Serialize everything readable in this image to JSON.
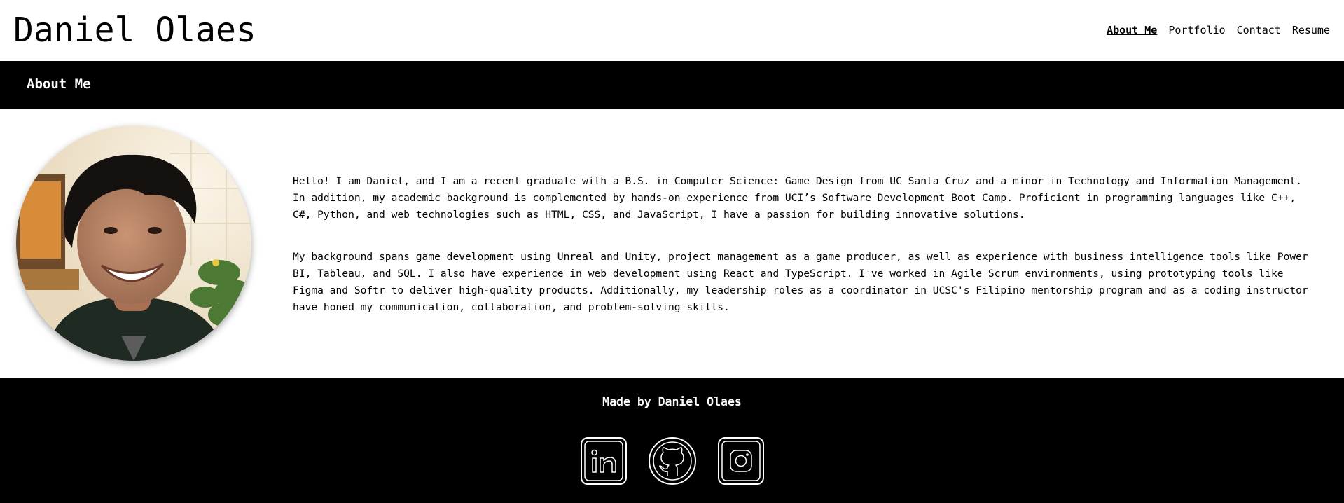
{
  "header": {
    "title": "Daniel Olaes",
    "nav": [
      {
        "label": "About Me",
        "active": true
      },
      {
        "label": "Portfolio",
        "active": false
      },
      {
        "label": "Contact",
        "active": false
      },
      {
        "label": "Resume",
        "active": false
      }
    ]
  },
  "section": {
    "title": "About Me"
  },
  "about": {
    "paragraphs": [
      "Hello! I am Daniel, and I am a recent graduate with a B.S. in Computer Science: Game Design from UC Santa Cruz and a minor in Technology and Information Management. In addition, my academic background is complemented by hands-on experience from UCI’s Software Development Boot Camp. Proficient in programming languages like C++, C#, Python, and web technologies such as HTML, CSS, and JavaScript, I have a passion for building innovative solutions.",
      "My background spans game development using Unreal and Unity, project management as a game producer, as well as experience with business intelligence tools like Power BI, Tableau, and SQL. I also have experience in web development using React and TypeScript. I've worked in Agile Scrum environments, using prototyping tools like Figma and Softr to deliver high-quality products. Additionally, my leadership roles as a coordinator in UCSC's Filipino mentorship program and as a coding instructor have honed my communication, collaboration, and problem-solving skills."
    ]
  },
  "footer": {
    "credit": "Made by Daniel Olaes",
    "socials": [
      {
        "icon": "linkedin-icon"
      },
      {
        "icon": "github-icon"
      },
      {
        "icon": "instagram-icon"
      }
    ]
  },
  "colors": {
    "bar": "#000000",
    "background": "#ffffff",
    "text_on_dark": "#ffffff"
  }
}
